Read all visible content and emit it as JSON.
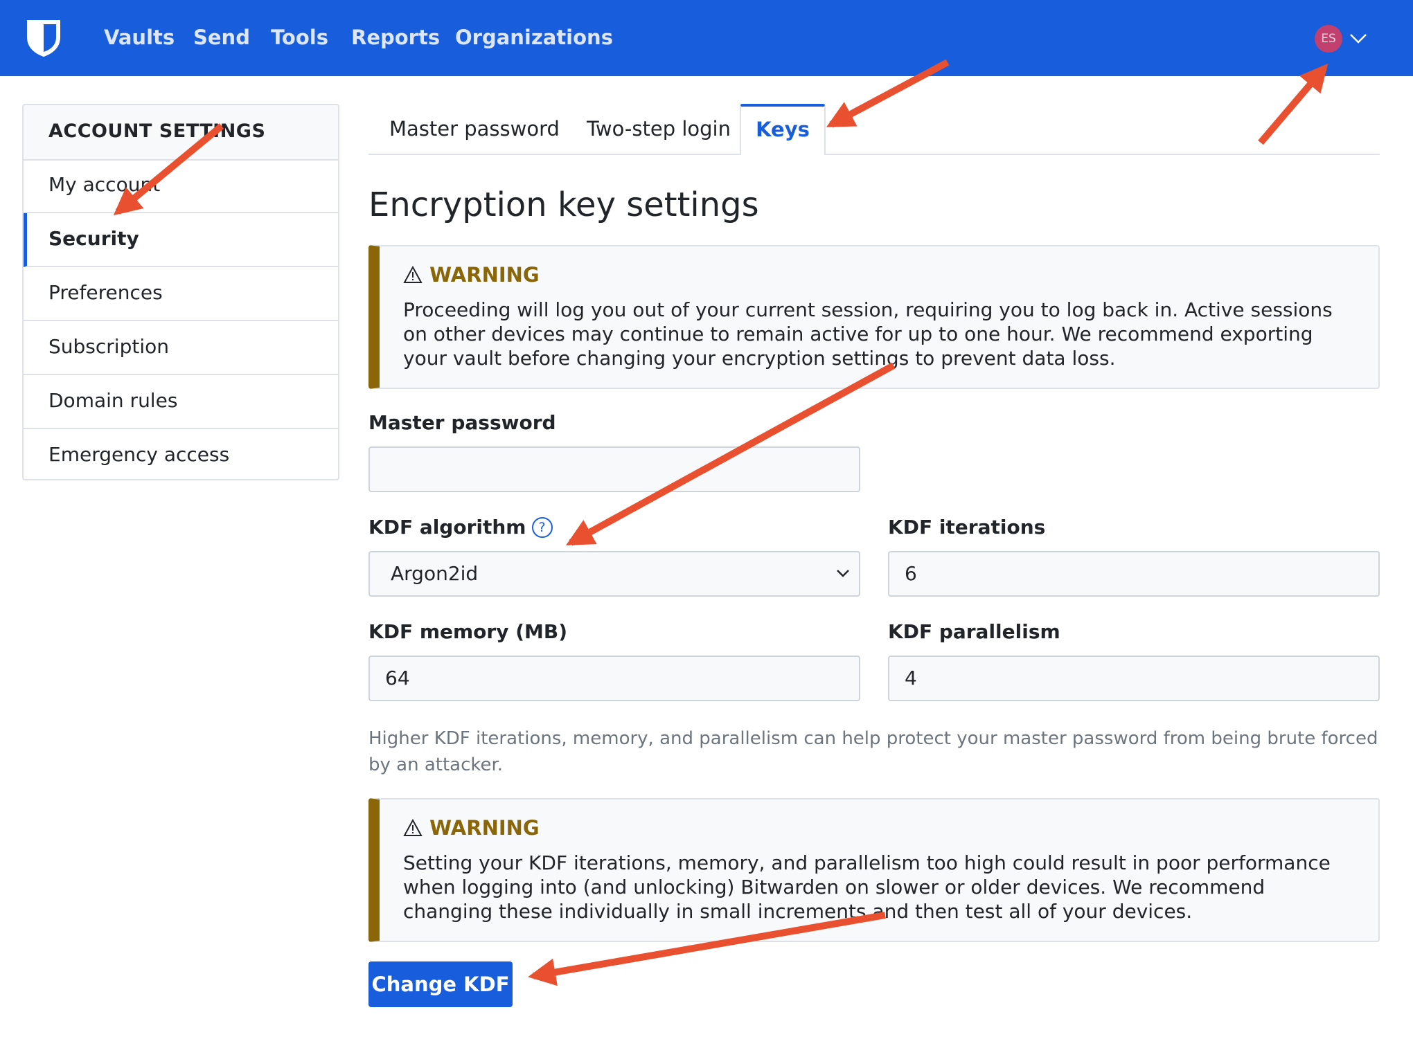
{
  "navbar": {
    "links": [
      "Vaults",
      "Send",
      "Tools",
      "Reports",
      "Organizations"
    ],
    "avatar_initials": "ES",
    "brand_color": "#175ddc"
  },
  "sidebar": {
    "heading": "ACCOUNT SETTINGS",
    "items": [
      "My account",
      "Security",
      "Preferences",
      "Subscription",
      "Domain rules",
      "Emergency access"
    ],
    "active": "Security"
  },
  "tabs": {
    "items": [
      "Master password",
      "Two-step login",
      "Keys"
    ],
    "active": "Keys"
  },
  "page": {
    "title": "Encryption key settings"
  },
  "warning1": {
    "title": "WARNING",
    "body": "Proceeding will log you out of your current session, requiring you to log back in. Active sessions on other devices may continue to remain active for up to one hour. We recommend exporting your vault before changing your encryption settings to prevent data loss."
  },
  "form": {
    "master_password_label": "Master password",
    "master_password_value": "",
    "kdf_algorithm_label": "KDF algorithm",
    "kdf_algorithm_value": "Argon2id",
    "kdf_iterations_label": "KDF iterations",
    "kdf_iterations_value": "6",
    "kdf_memory_label": "KDF memory (MB)",
    "kdf_memory_value": "64",
    "kdf_parallelism_label": "KDF parallelism",
    "kdf_parallelism_value": "4",
    "hint": "Higher KDF iterations, memory, and parallelism can help protect your master password from being brute forced by an attacker."
  },
  "warning2": {
    "title": "WARNING",
    "body": "Setting your KDF iterations, memory, and parallelism too high could result in poor performance when logging into (and unlocking) Bitwarden on slower or older devices. We recommend changing these individually in small increments and then test all of your devices."
  },
  "actions": {
    "submit_label": "Change KDF"
  },
  "colors": {
    "warning": "#8b6609",
    "annotation_arrow": "#e8502f"
  }
}
